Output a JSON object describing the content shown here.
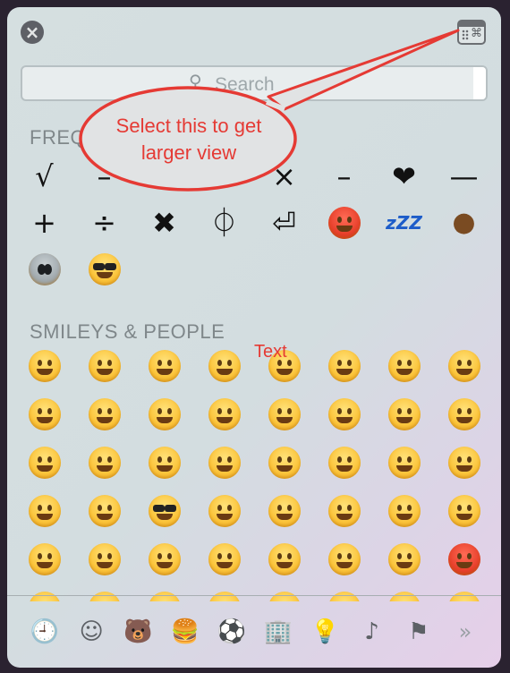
{
  "header": {
    "close_icon": "×",
    "viewer_icon": "⌘"
  },
  "search": {
    "placeholder": "Search",
    "icon": "⚲"
  },
  "sections": {
    "frequent": {
      "title": "FREQ"
    },
    "smileys": {
      "title": "SMILEYS & PEOPLE"
    }
  },
  "frequent": {
    "row1": [
      "√",
      "–",
      "×",
      "–",
      "❤",
      "—"
    ],
    "row2": [
      "+",
      "÷",
      "✖",
      "⏀",
      "⏎",
      "",
      "zZZ",
      ""
    ]
  },
  "tabs": [
    "🕘",
    "☺",
    "🐻",
    "🍔",
    "⚽",
    "🏢",
    "💡",
    "♪",
    "⚑",
    "»"
  ],
  "annotation": {
    "callout_line1": "Select this to get",
    "callout_line2": "larger view",
    "text_tag": "Text",
    "color": "#e53a34"
  }
}
